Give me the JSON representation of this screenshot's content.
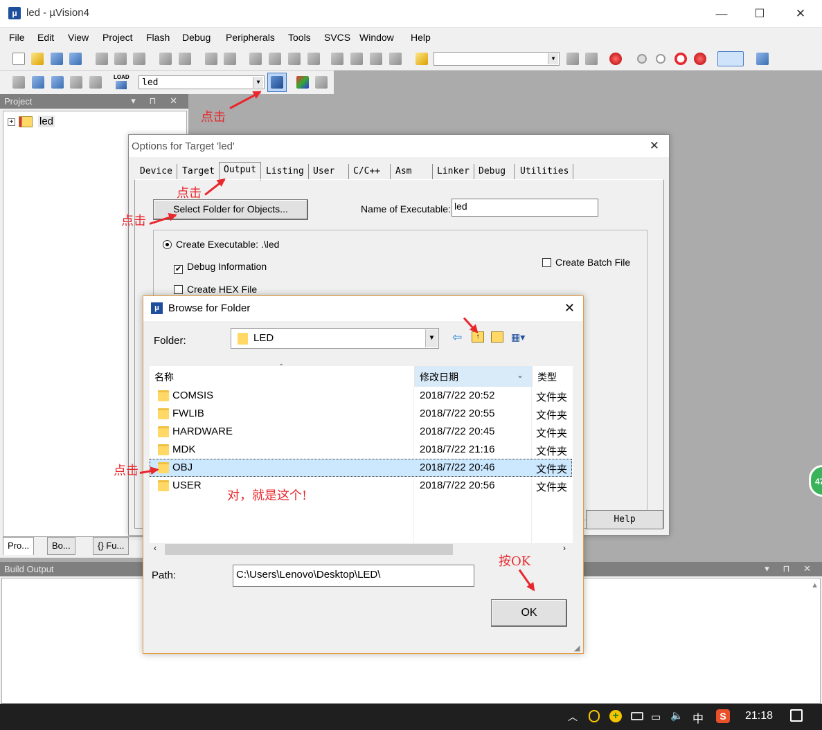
{
  "app": {
    "title": "led  - µVision4",
    "minimize": "—",
    "maximize": "☐",
    "close": "✕"
  },
  "menu": [
    "File",
    "Edit",
    "View",
    "Project",
    "Flash",
    "Debug",
    "Peripherals",
    "Tools",
    "SVCS",
    "Window",
    "Help"
  ],
  "toolbar2": {
    "target_select": "led",
    "load_label": "LOAD"
  },
  "project_panel": {
    "title": "Project",
    "tree_root": "led",
    "tabs": [
      "Pro...",
      "Bo...",
      "{} Fu..."
    ]
  },
  "build_output": {
    "title": "Build Output"
  },
  "options_dialog": {
    "title": "Options for Target 'led'",
    "tabs": [
      "Device",
      "Target",
      "Output",
      "Listing",
      "User",
      "C/C++",
      "Asm",
      "Linker",
      "Debug",
      "Utilities"
    ],
    "active_tab": "Output",
    "select_folder_button": "Select Folder for Objects...",
    "name_exec_label": "Name of Executable:",
    "name_exec_value": "led",
    "create_exec_label": "Create Executable:  .\\led",
    "debug_info_label": "Debug Information",
    "create_hex_label": "Create HEX File",
    "create_batch_label": "Create Batch File",
    "help_button": "Help"
  },
  "browse_dialog": {
    "title": "Browse for Folder",
    "folder_label": "Folder:",
    "folder_value": "LED",
    "columns": {
      "name": "名称",
      "date": "修改日期",
      "type": "类型"
    },
    "rows": [
      {
        "name": "COMSIS",
        "date": "2018/7/22 20:52",
        "type": "文件夹"
      },
      {
        "name": "FWLIB",
        "date": "2018/7/22 20:55",
        "type": "文件夹"
      },
      {
        "name": "HARDWARE",
        "date": "2018/7/22 20:45",
        "type": "文件夹"
      },
      {
        "name": "MDK",
        "date": "2018/7/22 21:16",
        "type": "文件夹"
      },
      {
        "name": "OBJ",
        "date": "2018/7/22 20:46",
        "type": "文件夹"
      },
      {
        "name": "USER",
        "date": "2018/7/22 20:56",
        "type": "文件夹"
      }
    ],
    "selected_row": 4,
    "path_label": "Path:",
    "path_value": "C:\\Users\\Lenovo\\Desktop\\LED\\",
    "ok_button": "OK"
  },
  "annotations": {
    "click1": "点击",
    "click2": "点击",
    "click3": "点击",
    "click4": "点击",
    "this_one": "对，就是这个!",
    "press_ok": "按OK"
  },
  "side_badge": "47",
  "taskbar": {
    "ime": "中",
    "time": "21:18"
  },
  "colors": {
    "accent_red": "#e8262b",
    "selection": "#cce8ff",
    "dialog_border": "#e49b3a"
  }
}
